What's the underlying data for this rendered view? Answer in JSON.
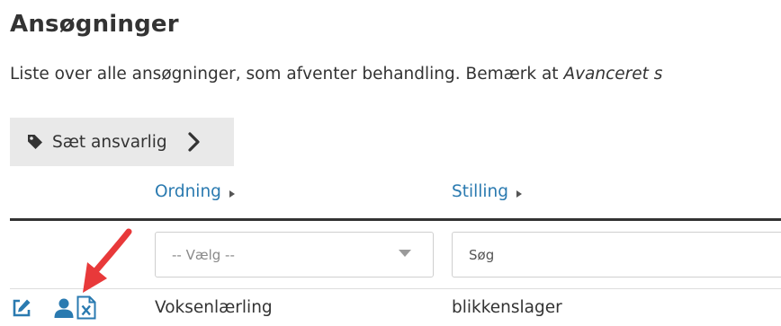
{
  "page": {
    "title": "Ansøgninger",
    "intro_text": "Liste over alle ansøgninger, som afventer behandling. Bemærk at ",
    "intro_emphasis": "Avanceret s"
  },
  "toolbar": {
    "assign_label": "Sæt ansvarlig",
    "assign_icon": "tag-icon",
    "assign_more_icon": "chevron-right-icon"
  },
  "table": {
    "columns": [
      {
        "label": "Ordning",
        "sort_icon": "caret-right-icon"
      },
      {
        "label": "Stilling",
        "sort_icon": "caret-right-icon"
      }
    ],
    "filters": {
      "ordning_select": "-- Vælg --",
      "stilling_search_placeholder": "Søg"
    },
    "rows": [
      {
        "actions": [
          "edit-icon",
          "user-icon",
          "excel-icon"
        ],
        "ordning": "Voksenlærling",
        "stilling": "blikkenslager"
      }
    ]
  },
  "colors": {
    "accent": "#2a7ab0",
    "annotation": "#e8393a",
    "button_bg": "#e9e9e9",
    "header_rule": "#333333"
  }
}
